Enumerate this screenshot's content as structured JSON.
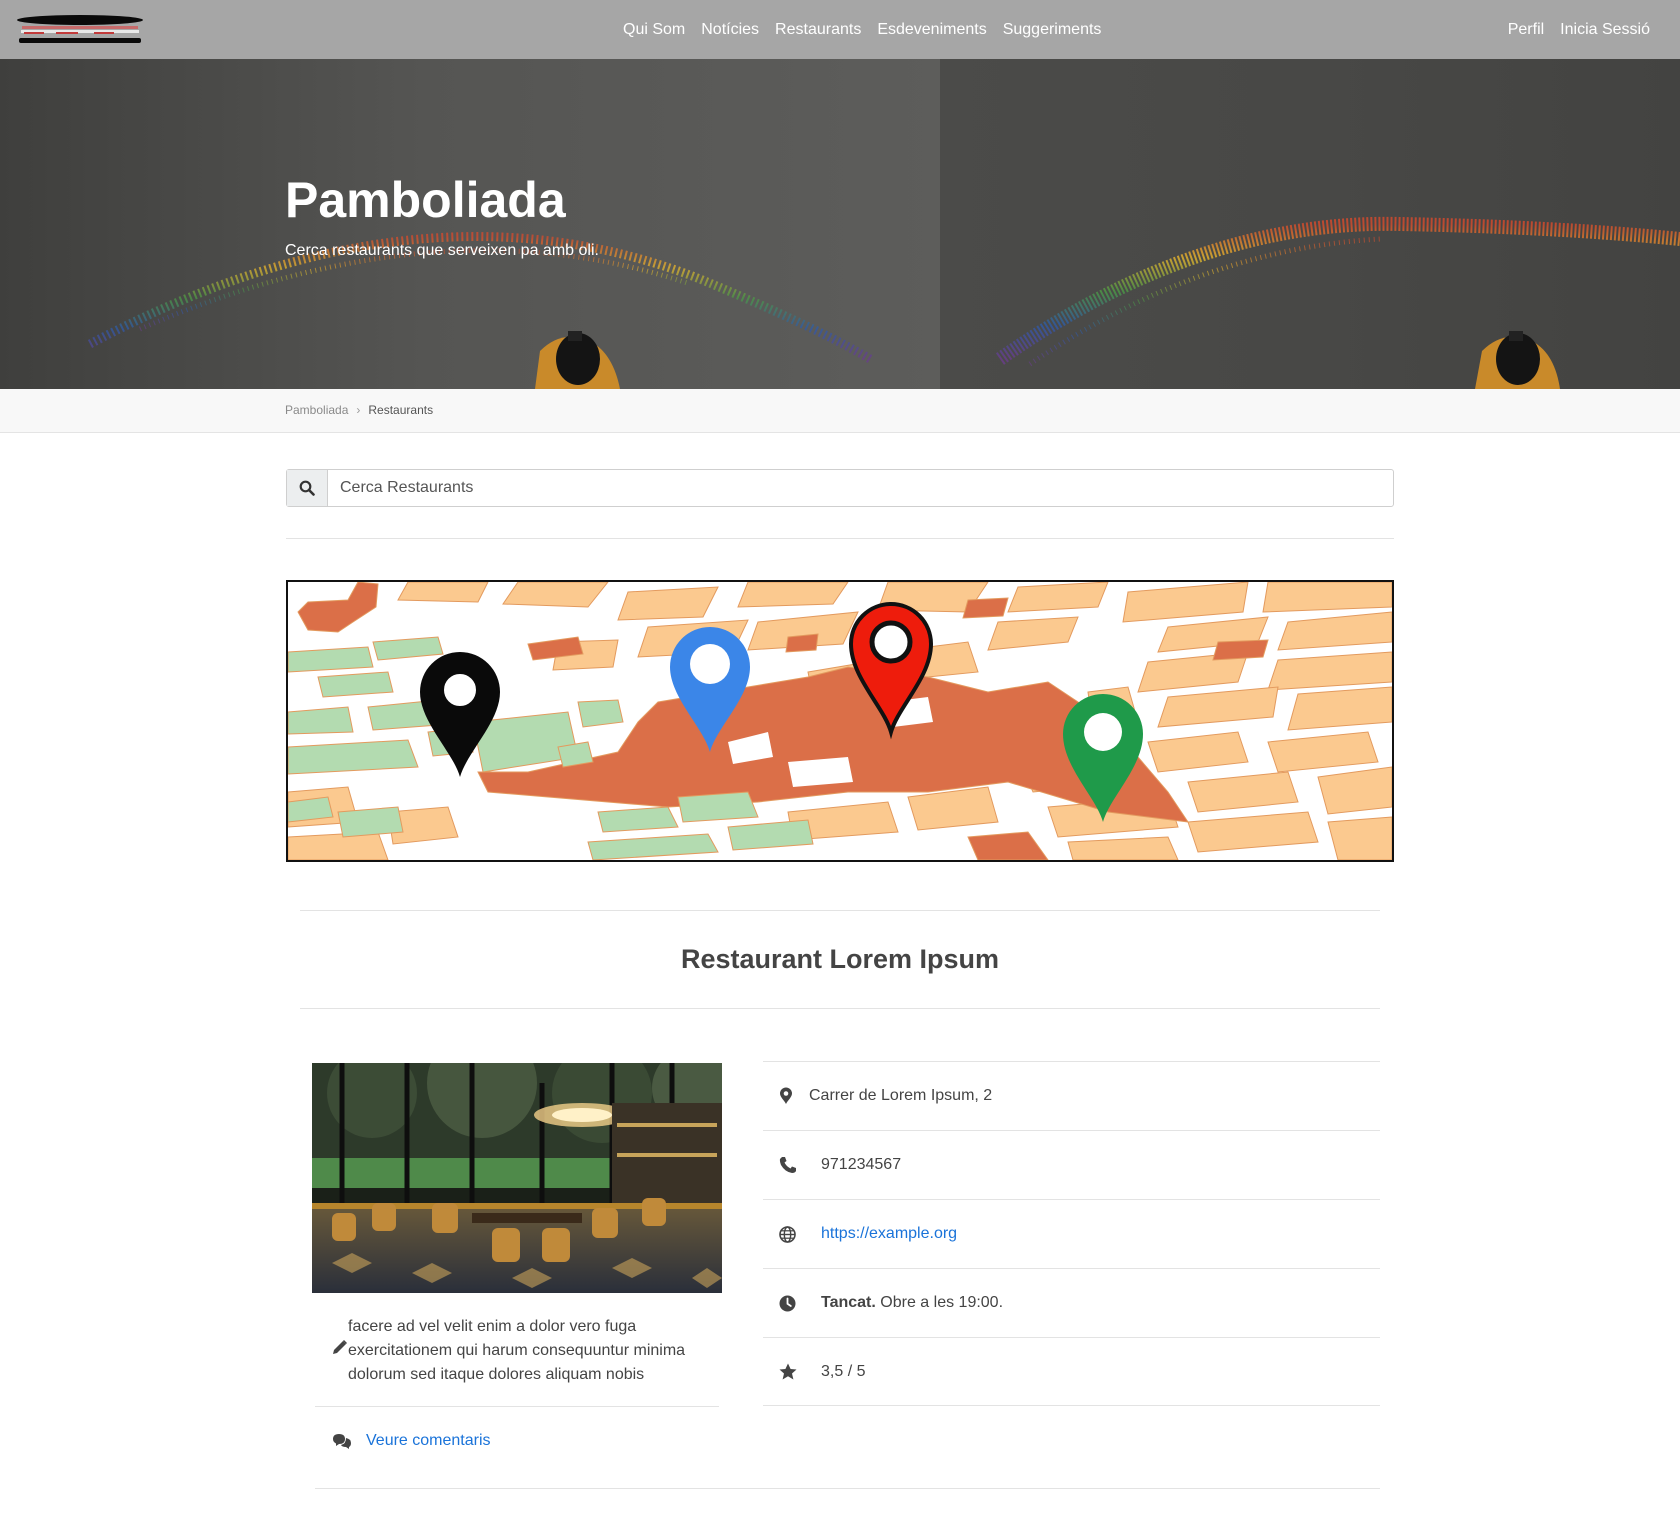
{
  "nav": {
    "logo_alt": "",
    "links": [
      "Qui Som",
      "Notícies",
      "Restaurants",
      "Esdeveniments",
      "Suggeriments"
    ],
    "right_links": [
      "Perfil",
      "Inicia Sessió"
    ]
  },
  "hero": {
    "title": "Pamboliada",
    "subtitle": "Cerca restaurants que serveixen pa amb oli."
  },
  "breadcrumb": {
    "home": "Pamboliada",
    "separator": "›",
    "current": "Restaurants"
  },
  "search": {
    "placeholder": "Cerca Restaurants",
    "icon": "search-icon"
  },
  "map": {
    "pins": [
      {
        "color": "#000000",
        "name": "black-pin"
      },
      {
        "color": "#3b86e8",
        "name": "blue-pin"
      },
      {
        "color": "#ee1c0c",
        "name": "red-pin"
      },
      {
        "color": "#1f9a4a",
        "name": "green-pin"
      }
    ]
  },
  "restaurant": {
    "title": "Restaurant Lorem Ipsum",
    "description": "facere ad vel velit enim a dolor vero fuga exercitationem qui harum consequuntur minima dolorum sed itaque dolores aliquam nobis",
    "comments_label": "Veure comentaris",
    "address": "Carrer de Lorem Ipsum, 2",
    "phone": "971234567",
    "website": "https://example.org",
    "status_bold": "Tancat.",
    "status_rest": "Obre a les 19:00.",
    "rating": "3,5 / 5"
  },
  "colors": {
    "navbar": "#a6a6a6",
    "link": "#1a73d9",
    "text": "#444444"
  }
}
